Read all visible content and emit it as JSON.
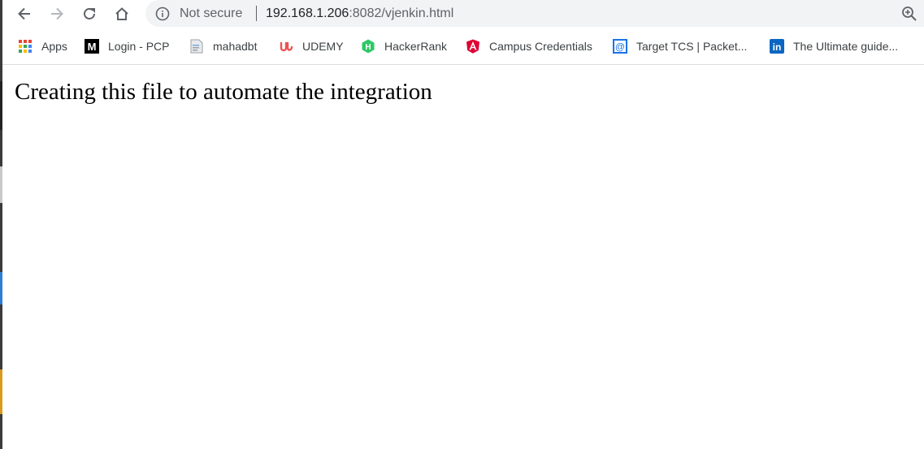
{
  "colors": {
    "toolbar_bg": "#ffffff",
    "omnibox_bg": "#f1f3f4",
    "text_primary": "#202124",
    "text_secondary": "#5f6368",
    "apps_dots": [
      "#ea4335",
      "#fbbc04",
      "#34a853",
      "#4285f4"
    ],
    "udemy": "#ec5252",
    "hackerrank": "#2ec866",
    "angular": "#dd0031",
    "target_tcs": "#1a73e8",
    "linkedin": "#0a66c2"
  },
  "nav": {
    "back_icon": "arrow-left",
    "forward_icon": "arrow-right",
    "reload_icon": "reload",
    "home_icon": "home"
  },
  "omnibox": {
    "security_label": "Not secure",
    "url_host": "192.168.1.206",
    "url_rest": ":8082/vjenkin.html",
    "zoom_icon": "zoom-in"
  },
  "bookmarks": [
    {
      "label": "Apps",
      "icon": "apps-grid"
    },
    {
      "label": "Login - PCP",
      "icon": "m-logo"
    },
    {
      "label": "mahadbt",
      "icon": "document-page"
    },
    {
      "label": "UDEMY",
      "icon": "udemy-logo"
    },
    {
      "label": "HackerRank",
      "icon": "hackerrank-logo"
    },
    {
      "label": "Campus Credentials",
      "icon": "angular-logo"
    },
    {
      "label": "Target TCS | Packet...",
      "icon": "at-sign"
    },
    {
      "label": "The Ultimate guide...",
      "icon": "linkedin-logo"
    }
  ],
  "page": {
    "text": "Creating this file to automate the integration"
  }
}
